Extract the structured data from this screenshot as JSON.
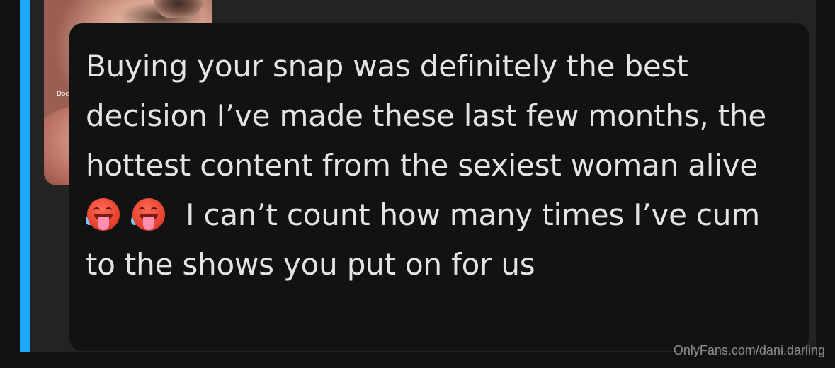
{
  "photo": {
    "caption": "Doc"
  },
  "message": {
    "part1": "Buying your snap was definitely the best decision I’ve made these last few months, the hottest content from the sexiest woman alive ",
    "emoji1": "hot-face-emoji",
    "emoji2": "hot-face-emoji",
    "part2": " I can’t count how many times I’ve cum to the shows you put on for us"
  },
  "watermark": "OnlyFans.com/dani.darling",
  "colors": {
    "accent": "#1ea7ff",
    "background": "#121212",
    "panel": "#232323",
    "message_text": "#e4e4e4"
  }
}
